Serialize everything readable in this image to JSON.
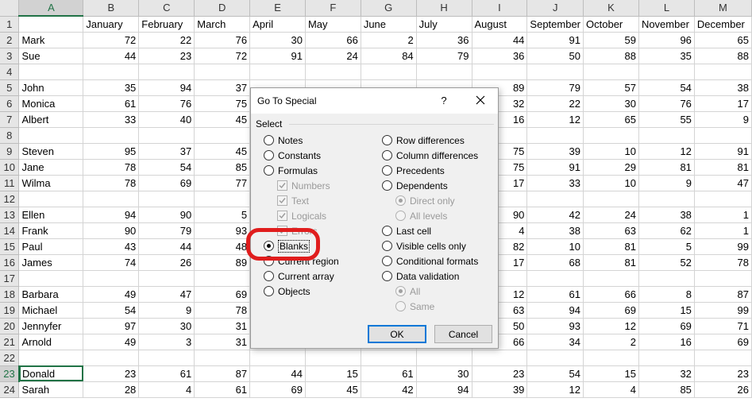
{
  "columns": [
    "A",
    "B",
    "C",
    "D",
    "E",
    "F",
    "G",
    "H",
    "I",
    "J",
    "K",
    "L",
    "M"
  ],
  "selected_column": "A",
  "header_row": [
    "",
    "January",
    "February",
    "March",
    "April",
    "May",
    "June",
    "July",
    "August",
    "September",
    "October",
    "November",
    "December"
  ],
  "rows": [
    {
      "n": "1",
      "cells": [
        "",
        "January",
        "February",
        "March",
        "April",
        "May",
        "June",
        "July",
        "August",
        "September",
        "October",
        "November",
        "December"
      ]
    },
    {
      "n": "2",
      "cells": [
        "Mark",
        "72",
        "22",
        "76",
        "30",
        "66",
        "2",
        "36",
        "44",
        "91",
        "59",
        "96",
        "65"
      ]
    },
    {
      "n": "3",
      "cells": [
        "Sue",
        "44",
        "23",
        "72",
        "91",
        "24",
        "84",
        "79",
        "36",
        "50",
        "88",
        "35",
        "88"
      ]
    },
    {
      "n": "4",
      "cells": [
        "",
        "",
        "",
        "",
        "",
        "",
        "",
        "",
        "",
        "",
        "",
        "",
        ""
      ]
    },
    {
      "n": "5",
      "cells": [
        "John",
        "35",
        "94",
        "37",
        "",
        "",
        "",
        "",
        "89",
        "79",
        "57",
        "54",
        "38"
      ]
    },
    {
      "n": "6",
      "cells": [
        "Monica",
        "61",
        "76",
        "75",
        "",
        "",
        "",
        "",
        "32",
        "22",
        "30",
        "76",
        "17"
      ]
    },
    {
      "n": "7",
      "cells": [
        "Albert",
        "33",
        "40",
        "45",
        "",
        "",
        "",
        "",
        "16",
        "12",
        "65",
        "55",
        "9"
      ]
    },
    {
      "n": "8",
      "cells": [
        "",
        "",
        "",
        "",
        "",
        "",
        "",
        "",
        "",
        "",
        "",
        "",
        ""
      ]
    },
    {
      "n": "9",
      "cells": [
        "Steven",
        "95",
        "37",
        "45",
        "",
        "",
        "",
        "",
        "75",
        "39",
        "10",
        "12",
        "91"
      ]
    },
    {
      "n": "10",
      "cells": [
        "Jane",
        "78",
        "54",
        "85",
        "",
        "",
        "",
        "",
        "75",
        "91",
        "29",
        "81",
        "81"
      ]
    },
    {
      "n": "11",
      "cells": [
        "Wilma",
        "78",
        "69",
        "77",
        "",
        "",
        "",
        "",
        "17",
        "33",
        "10",
        "9",
        "47"
      ]
    },
    {
      "n": "12",
      "cells": [
        "",
        "",
        "",
        "",
        "",
        "",
        "",
        "",
        "",
        "",
        "",
        "",
        ""
      ]
    },
    {
      "n": "13",
      "cells": [
        "Ellen",
        "94",
        "90",
        "5",
        "",
        "",
        "",
        "",
        "90",
        "42",
        "24",
        "38",
        "1"
      ]
    },
    {
      "n": "14",
      "cells": [
        "Frank",
        "90",
        "79",
        "93",
        "",
        "",
        "",
        "",
        "4",
        "38",
        "63",
        "62",
        "1"
      ]
    },
    {
      "n": "15",
      "cells": [
        "Paul",
        "43",
        "44",
        "48",
        "",
        "",
        "",
        "",
        "82",
        "10",
        "81",
        "5",
        "99"
      ]
    },
    {
      "n": "16",
      "cells": [
        "James",
        "74",
        "26",
        "89",
        "",
        "",
        "",
        "",
        "17",
        "68",
        "81",
        "52",
        "78"
      ]
    },
    {
      "n": "17",
      "cells": [
        "",
        "",
        "",
        "",
        "",
        "",
        "",
        "",
        "",
        "",
        "",
        "",
        ""
      ]
    },
    {
      "n": "18",
      "cells": [
        "Barbara",
        "49",
        "47",
        "69",
        "",
        "",
        "",
        "",
        "12",
        "61",
        "66",
        "8",
        "87"
      ]
    },
    {
      "n": "19",
      "cells": [
        "Michael",
        "54",
        "9",
        "78",
        "",
        "",
        "",
        "",
        "63",
        "94",
        "69",
        "15",
        "99"
      ]
    },
    {
      "n": "20",
      "cells": [
        "Jennyfer",
        "97",
        "30",
        "31",
        "",
        "",
        "",
        "",
        "50",
        "93",
        "12",
        "69",
        "71"
      ]
    },
    {
      "n": "21",
      "cells": [
        "Arnold",
        "49",
        "3",
        "31",
        "",
        "",
        "",
        "",
        "66",
        "34",
        "2",
        "16",
        "69"
      ]
    },
    {
      "n": "22",
      "cells": [
        "",
        "",
        "",
        "",
        "",
        "",
        "",
        "",
        "",
        "",
        "",
        "",
        ""
      ]
    },
    {
      "n": "23",
      "cells": [
        "Donald",
        "23",
        "61",
        "87",
        "44",
        "15",
        "61",
        "30",
        "23",
        "54",
        "15",
        "32",
        "23"
      ]
    },
    {
      "n": "24",
      "cells": [
        "Sarah",
        "28",
        "4",
        "61",
        "69",
        "45",
        "42",
        "94",
        "39",
        "12",
        "4",
        "85",
        "26"
      ]
    }
  ],
  "active_row": "23",
  "dialog": {
    "title": "Go To Special",
    "help_label": "?",
    "section_label": "Select",
    "left_options": [
      "Notes",
      "Constants",
      "Formulas",
      "Numbers",
      "Text",
      "Logicals",
      "Errors",
      "Blanks",
      "Current region",
      "Current array",
      "Objects"
    ],
    "right_options": [
      "Row differences",
      "Column differences",
      "Precedents",
      "Dependents",
      "Direct only",
      "All levels",
      "Last cell",
      "Visible cells only",
      "Conditional formats",
      "Data validation",
      "All",
      "Same"
    ],
    "selected_option": "Blanks",
    "ok_label": "OK",
    "cancel_label": "Cancel"
  },
  "highlight_color": "#e01d1d",
  "accent_color": "#217346"
}
